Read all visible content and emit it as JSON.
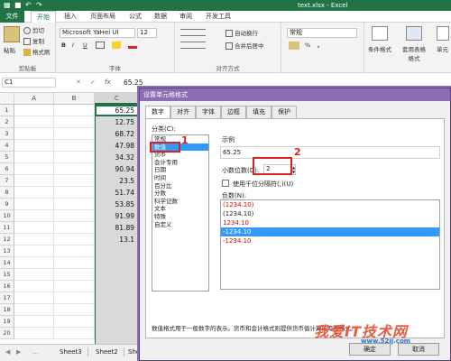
{
  "window": {
    "title": "text.xlsx - Excel"
  },
  "colors": {
    "excel_green": "#217346",
    "dialog_purple": "#8b6db2",
    "selection_blue": "#3399ff",
    "annotation_red": "#e02020",
    "negative_red": "#e00000"
  },
  "tabs": [
    "文件",
    "开始",
    "插入",
    "页面布局",
    "公式",
    "数据",
    "审阅",
    "开发工具"
  ],
  "ribbon": {
    "clipboard": {
      "paste": "粘贴",
      "cut": "剪切",
      "copy": "复制",
      "format_painter": "格式刷",
      "group": "剪贴板"
    },
    "font": {
      "name": "Microsoft YaHei UI",
      "size": "12",
      "bold": "B",
      "italic": "I",
      "underline": "U",
      "group": "字体"
    },
    "alignment": {
      "wrap": "自动换行",
      "merge": "合并后居中",
      "group": "对齐方式"
    },
    "number": {
      "format": "常规",
      "percent": "%",
      "comma": ","
    },
    "styles": {
      "conditional": "条件格式",
      "table": "套用表格格式",
      "cell": "单元"
    }
  },
  "formula_bar": {
    "name_box": "C1",
    "fx": "fx",
    "value": "65.25"
  },
  "grid": {
    "columns": [
      "A",
      "B",
      "C"
    ],
    "rows": [
      "1",
      "2",
      "3",
      "4",
      "5",
      "6",
      "7",
      "8",
      "9",
      "10",
      "11",
      "12",
      "13",
      "14",
      "15",
      "16",
      "17",
      "18",
      "19",
      "20"
    ],
    "values": [
      "65.25",
      "12.75",
      "68.72",
      "47.98",
      "34.32",
      "90.94",
      "23.5",
      "51.74",
      "53.85",
      "91.99",
      "81.89",
      "13.1"
    ]
  },
  "sheets": [
    "Sheet3",
    "Sheet2",
    "She"
  ],
  "dialog": {
    "title": "设置单元格格式",
    "tabs": [
      "数字",
      "对齐",
      "字体",
      "边框",
      "填充",
      "保护"
    ],
    "category_label": "分类(C):",
    "categories": [
      "常规",
      "数值",
      "货币",
      "会计专用",
      "日期",
      "时间",
      "百分比",
      "分数",
      "科学记数",
      "文本",
      "特殊",
      "自定义"
    ],
    "sample_label": "示例",
    "sample_value": "65.25",
    "decimal_label": "小数位数(D):",
    "decimal_value": "2",
    "thousands_label": "使用千位分隔符(,)(U)",
    "negative_label": "负数(N):",
    "negative_options": [
      "(1234.10)",
      "(1234.10)",
      "1234.10",
      "-1234.10",
      "-1234.10"
    ],
    "description": "数值格式用于一般数字的表示。货币和会计格式则提供货币值计算的专用格式。",
    "ok": "确定",
    "cancel": "取消",
    "marker_1": "1",
    "marker_2": "2"
  },
  "watermark": {
    "text": "我爱IT技术网",
    "url": "www.52ij.com"
  }
}
